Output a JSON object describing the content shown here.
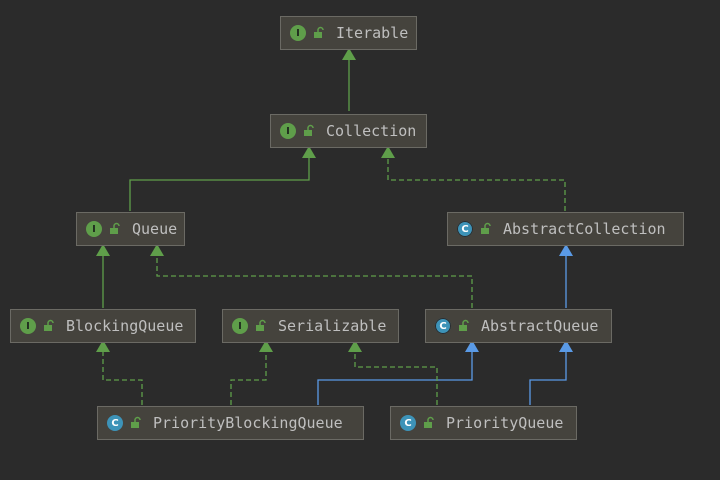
{
  "colors": {
    "background": "#2b2b2b",
    "node_fill": "#45433d",
    "node_border": "#6b6a64",
    "text": "#bfbfbf",
    "interface_badge": "#5f9e4a",
    "class_badge": "#3d93b8",
    "interface_edge": "#5f9e4a",
    "extends_edge": "#5a9ae6"
  },
  "nodes": [
    {
      "id": "iterable",
      "label": "Iterable",
      "kind": "I"
    },
    {
      "id": "collection",
      "label": "Collection",
      "kind": "I"
    },
    {
      "id": "queue",
      "label": "Queue",
      "kind": "I"
    },
    {
      "id": "abstract_collection",
      "label": "AbstractCollection",
      "kind": "C"
    },
    {
      "id": "blocking_queue",
      "label": "BlockingQueue",
      "kind": "I"
    },
    {
      "id": "serializable",
      "label": "Serializable",
      "kind": "I"
    },
    {
      "id": "abstract_queue",
      "label": "AbstractQueue",
      "kind": "C"
    },
    {
      "id": "priority_blocking_queue",
      "label": "PriorityBlockingQueue",
      "kind": "C"
    },
    {
      "id": "priority_queue",
      "label": "PriorityQueue",
      "kind": "C"
    }
  ],
  "edges": [
    {
      "from": "collection",
      "to": "iterable",
      "type": "extends-interface"
    },
    {
      "from": "queue",
      "to": "collection",
      "type": "extends-interface"
    },
    {
      "from": "abstract_collection",
      "to": "collection",
      "type": "implements"
    },
    {
      "from": "blocking_queue",
      "to": "queue",
      "type": "extends-interface"
    },
    {
      "from": "abstract_queue",
      "to": "queue",
      "type": "implements"
    },
    {
      "from": "abstract_queue",
      "to": "abstract_collection",
      "type": "extends"
    },
    {
      "from": "priority_blocking_queue",
      "to": "blocking_queue",
      "type": "implements"
    },
    {
      "from": "priority_blocking_queue",
      "to": "serializable",
      "type": "implements"
    },
    {
      "from": "priority_blocking_queue",
      "to": "abstract_queue",
      "type": "extends"
    },
    {
      "from": "priority_queue",
      "to": "serializable",
      "type": "implements"
    },
    {
      "from": "priority_queue",
      "to": "abstract_queue",
      "type": "extends"
    }
  ]
}
